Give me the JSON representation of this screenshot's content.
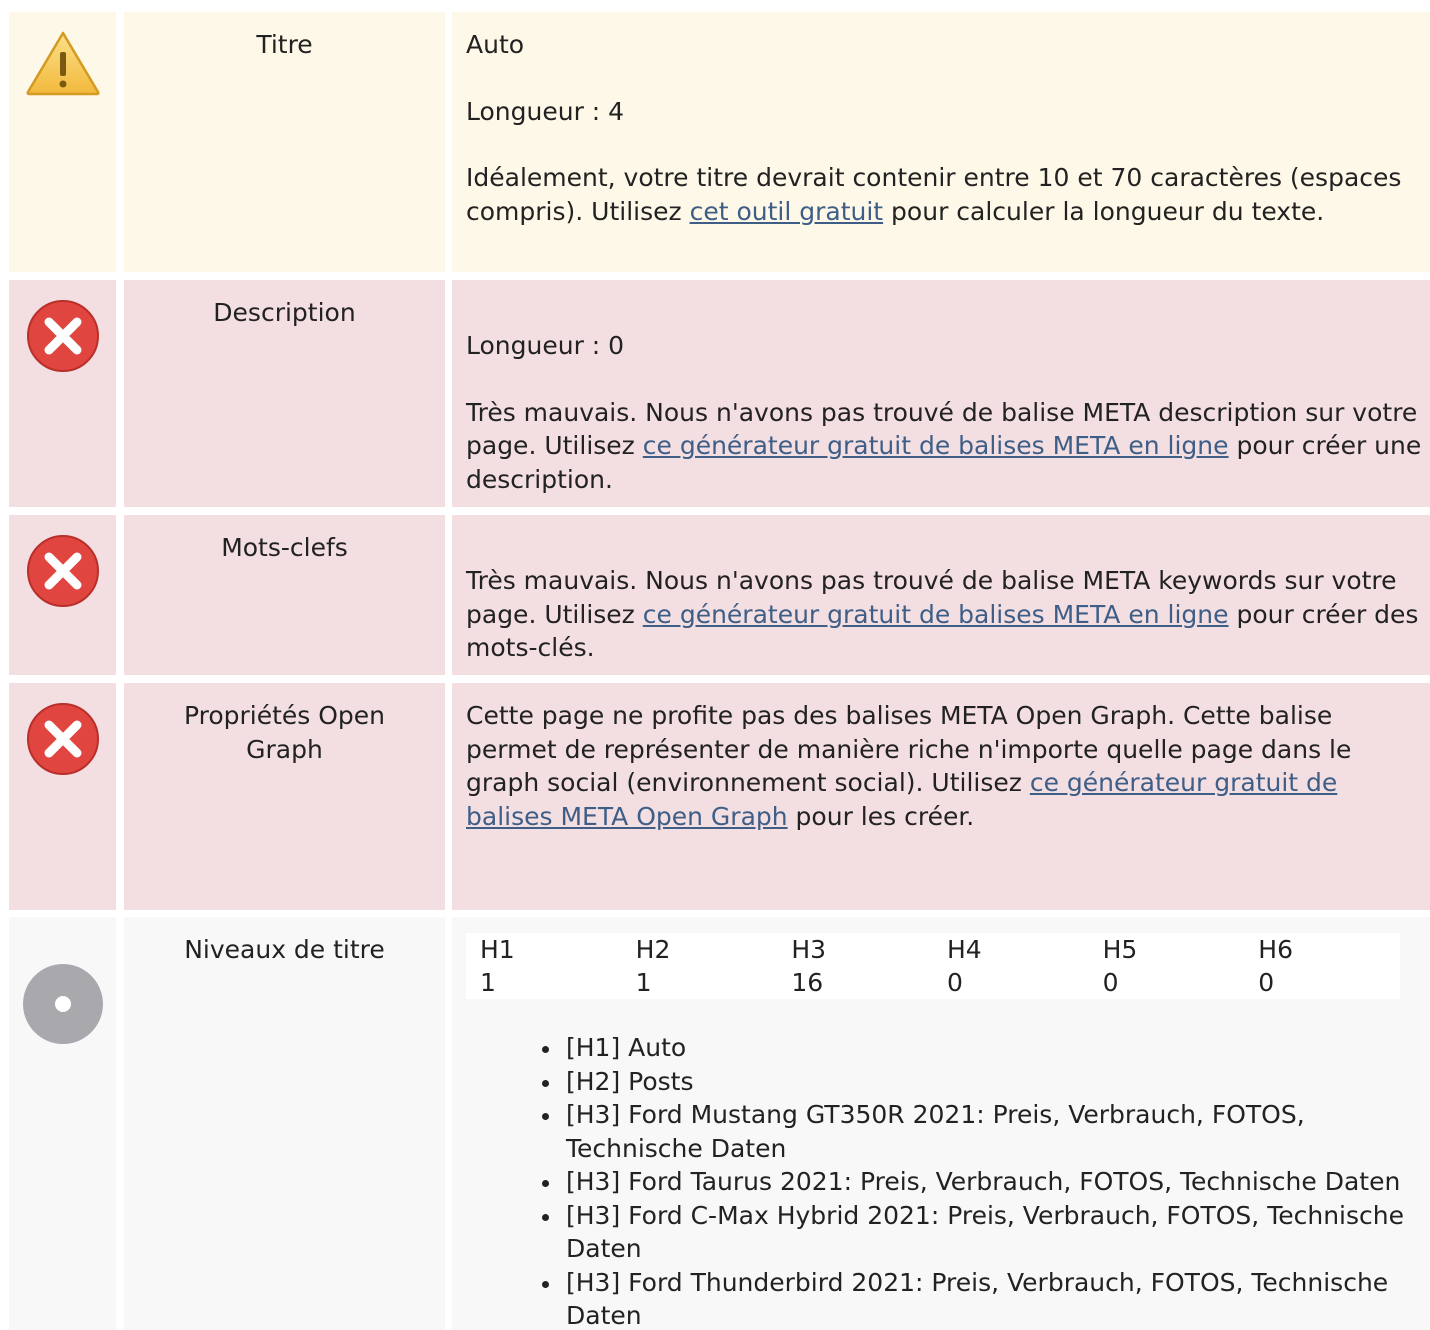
{
  "rows": {
    "title": {
      "label": "Titre",
      "value": "Auto",
      "length": "Longueur : 4",
      "text_before": "Idéalement, votre titre devrait contenir entre 10 et 70 caractères (espaces compris). Utilisez ",
      "link": "cet outil gratuit",
      "text_after": " pour calculer la longueur du texte."
    },
    "description": {
      "label": "Description",
      "length": "Longueur : 0",
      "text_before": "Très mauvais. Nous n'avons pas trouvé de balise META description sur votre page. Utilisez ",
      "link": "ce générateur gratuit de balises META en ligne",
      "text_after": " pour créer une description."
    },
    "keywords": {
      "label": "Mots-clefs",
      "text_before": "Très mauvais. Nous n'avons pas trouvé de balise META keywords sur votre page. Utilisez ",
      "link": "ce générateur gratuit de balises META en ligne",
      "text_after": " pour créer des mots-clés."
    },
    "open_graph": {
      "label": "Propriétés Open Graph",
      "text_before": "Cette page ne profite pas des balises META Open Graph. Cette balise permet de représenter de manière riche n'importe quelle page dans le graph social (environnement social). Utilisez ",
      "link": "ce générateur gratuit de balises META Open Graph",
      "text_after": " pour les créer."
    },
    "headings": {
      "label": "Niveaux de titre",
      "table_headers": [
        "H1",
        "H2",
        "H3",
        "H4",
        "H5",
        "H6"
      ],
      "table_values": [
        "1",
        "1",
        "16",
        "0",
        "0",
        "0"
      ],
      "list": [
        "[H1] Auto",
        "[H2] Posts",
        "[H3] Ford Mustang GT350R 2021: Preis, Verbrauch, FOTOS, Technische Daten",
        "[H3] Ford Taurus 2021: Preis, Verbrauch, FOTOS, Technische Daten",
        "[H3] Ford C-Max Hybrid 2021: Preis, Verbrauch, FOTOS, Technische Daten",
        "[H3] Ford Thunderbird 2021: Preis, Verbrauch, FOTOS, Technische Daten"
      ]
    }
  },
  "icons": {
    "warning": "warning-icon",
    "error": "error-icon",
    "neutral": "neutral-icon"
  },
  "colors": {
    "warning_bg": "#fdf8e8",
    "error_bg": "#f3dfe1",
    "neutral_bg": "#f8f8f8",
    "link": "#3e5e87",
    "error_icon": "#e0453f",
    "warning_icon": "#f4c54a",
    "neutral_icon": "#a9a9ad"
  }
}
